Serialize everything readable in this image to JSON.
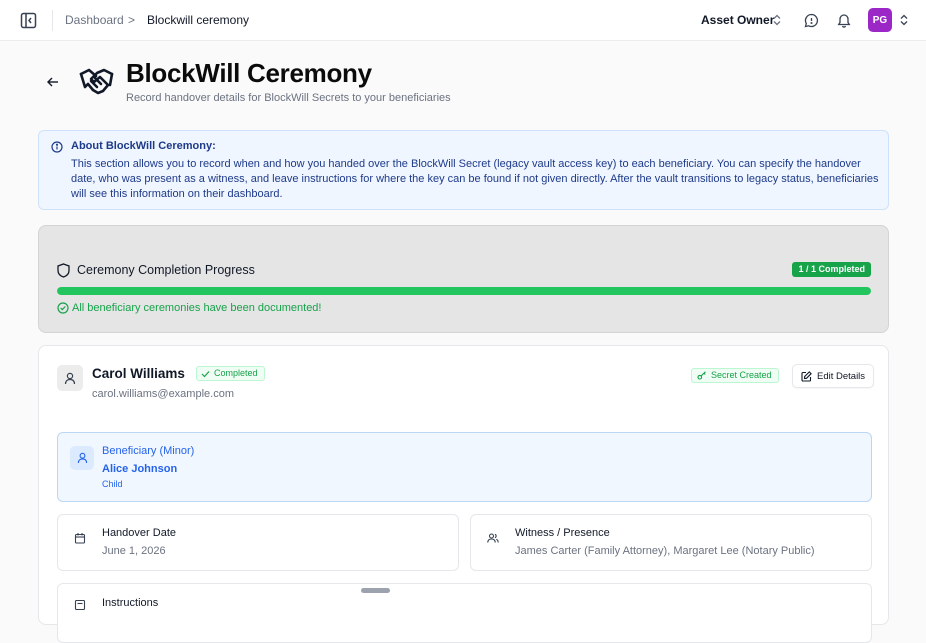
{
  "header": {
    "breadcrumb": [
      "Dashboard",
      "Blockwill ceremony"
    ],
    "breadcrumb_separator": ">",
    "role": "Asset Owner",
    "avatar_initials": "PG",
    "avatar_color": "#9b28c6",
    "icons": [
      "sidebar-toggle-icon",
      "chevron-up-down-icon",
      "chat-icon",
      "bell-icon"
    ]
  },
  "page": {
    "title": "BlockWill Ceremony",
    "subtitle": "Record handover details for BlockWill Secrets to your beneficiaries",
    "icons": [
      "back-arrow-icon",
      "handshake-icon"
    ]
  },
  "about": {
    "title": "About BlockWill Ceremony:",
    "body": "This section allows you to record when and how you handed over the BlockWill Secret (legacy vault access key) to each beneficiary. You can specify the handover date, who was present as a witness, and leave instructions for where the key can be found if not given directly. After the vault transitions to legacy status, beneficiaries will see this information on their dashboard."
  },
  "progress": {
    "title": "Ceremony Completion Progress",
    "badge": "1 / 1 Completed",
    "completed": 1,
    "total": 1,
    "fraction": 1.0,
    "status": "All beneficiary ceremonies have been documented!",
    "accent": "#22c55e"
  },
  "beneficiary": {
    "name": "Carol Williams",
    "status": "Completed",
    "email": "carol.williams@example.com",
    "secret_badge": "Secret Created",
    "edit_label": "Edit Details",
    "minor": {
      "label": "Beneficiary (Minor)",
      "name": "Alice Johnson",
      "relation": "Child"
    },
    "handover": {
      "label": "Handover Date",
      "value": "June 1, 2026"
    },
    "witness": {
      "label": "Witness / Presence",
      "value": "James Carter (Family Attorney), Margaret Lee (Notary Public)"
    },
    "instructions": {
      "label": "Instructions"
    }
  }
}
